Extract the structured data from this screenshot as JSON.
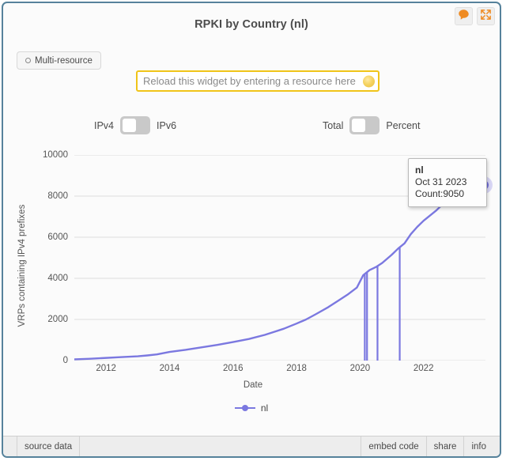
{
  "header": {
    "title": "RPKI by Country (nl)",
    "icons": [
      {
        "name": "comment-icon",
        "glyph": "speech-bubble",
        "color": "#ef8b22"
      },
      {
        "name": "expand-icon",
        "glyph": "fullscreen-arrows",
        "color": "#ef8b22"
      }
    ]
  },
  "controls": {
    "multi_resource_label": "Multi-resource",
    "search": {
      "value": "",
      "placeholder": "Reload this widget by entering a resource here",
      "border_color": "#f0c419",
      "loading": true
    },
    "toggles": [
      {
        "name": "protocol",
        "left_label": "IPv4",
        "right_label": "IPv6",
        "state": "left"
      },
      {
        "name": "measure",
        "left_label": "Total",
        "right_label": "Percent",
        "state": "left"
      }
    ]
  },
  "tooltip": {
    "series": "nl",
    "date": "Oct 31 2023",
    "count": "Count:9050"
  },
  "legend": {
    "entries": [
      {
        "label": "nl",
        "color": "#7b78e0"
      }
    ]
  },
  "footer": {
    "left": [
      "source data"
    ],
    "right": [
      "embed code",
      "share",
      "info"
    ]
  },
  "chart_data": {
    "type": "line",
    "title": "RPKI by Country (nl)",
    "xlabel": "Date",
    "ylabel": "VRPs containing IPv4 prefixes",
    "xlim": [
      "2011-01-01",
      "2023-12-31"
    ],
    "ylim": [
      0,
      10000
    ],
    "yticks": [
      10000,
      8000,
      6000,
      4000,
      2000,
      0
    ],
    "xticks": [
      "2012",
      "2014",
      "2016",
      "2018",
      "2020",
      "2022"
    ],
    "grid": true,
    "line_color": "#7b78e0",
    "legend_position": "bottom",
    "annotation": {
      "series": "nl",
      "date": "Oct 31 2023",
      "value": 9050
    },
    "series": [
      {
        "name": "nl",
        "color": "#7b78e0",
        "x": [
          "2011.0",
          "2011.5",
          "2012.0",
          "2012.5",
          "2013.0",
          "2013.3",
          "2013.6",
          "2014.0",
          "2014.5",
          "2015.0",
          "2015.5",
          "2016.0",
          "2016.5",
          "2017.0",
          "2017.3",
          "2017.6",
          "2018.0",
          "2018.3",
          "2018.6",
          "2019.0",
          "2019.3",
          "2019.6",
          "2019.9",
          "2020.1",
          "2020.3",
          "2020.5",
          "2020.7",
          "2021.0",
          "2021.2",
          "2021.4",
          "2021.6",
          "2021.8",
          "2022.0",
          "2022.2",
          "2022.4",
          "2022.6",
          "2022.8",
          "2023.0",
          "2023.3",
          "2023.6",
          "2023.83"
        ],
        "values": [
          60,
          90,
          130,
          170,
          210,
          250,
          300,
          420,
          520,
          640,
          760,
          900,
          1050,
          1250,
          1400,
          1550,
          1800,
          2000,
          2250,
          2600,
          2900,
          3200,
          3550,
          4150,
          4400,
          4550,
          4750,
          5150,
          5450,
          5700,
          6150,
          6500,
          6800,
          7050,
          7300,
          7600,
          7900,
          8200,
          8500,
          8800,
          9050
        ],
        "dropouts": [
          "2020.15",
          "2020.22",
          "2020.55",
          "2021.25"
        ]
      }
    ]
  }
}
